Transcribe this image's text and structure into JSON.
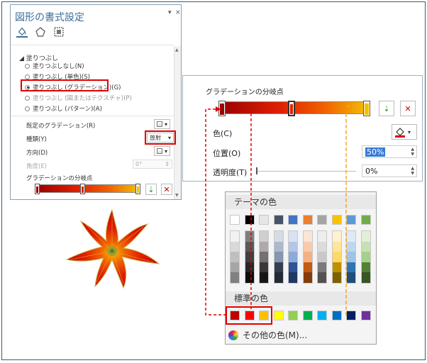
{
  "pane": {
    "title": "図形の書式設定",
    "pin_glyph": "▾",
    "close_glyph": "×",
    "tabs": [
      "fill-line-icon",
      "effects-icon",
      "size-properties-icon"
    ],
    "section": "塗りつぶし",
    "radios": [
      {
        "label": "塗りつぶしなし(N)",
        "checked": false,
        "dim": false
      },
      {
        "label": "塗りつぶし (単色)(S)",
        "checked": false,
        "dim": false
      },
      {
        "label": "塗りつぶし (グラデーション)(G)",
        "checked": true,
        "dim": false
      },
      {
        "label": "塗りつぶし (図またはテクスチャ)(P)",
        "checked": false,
        "dim": true
      },
      {
        "label": "塗りつぶし (パターン)(A)",
        "checked": false,
        "dim": false
      }
    ],
    "preset_label": "既定のグラデーション(R)",
    "type_label": "種類(Y)",
    "type_value": "放射",
    "direction_label": "方向(D)",
    "angle_label": "角度(E)",
    "angle_value": "0°",
    "stops_label": "グラデーションの分岐点"
  },
  "panel2": {
    "stops_label": "グラデーションの分岐点",
    "color_label": "色(C)",
    "position_label": "位置(O)",
    "position_value": "50%",
    "transparency_label": "透明度(T)",
    "transparency_value": "0%"
  },
  "popup": {
    "theme_header": "テーマの色",
    "standard_header": "標準の色",
    "more_colors": "その他の色(M)...",
    "theme_top": [
      "#ffffff",
      "#000000",
      "#e7e6e6",
      "#44546a",
      "#4472c4",
      "#ed7d31",
      "#a5a5a5",
      "#ffc000",
      "#5b9bd5",
      "#70ad47"
    ],
    "theme_columns": [
      [
        "#f2f2f2",
        "#d9d9d9",
        "#bfbfbf",
        "#a6a6a6",
        "#808080"
      ],
      [
        "#7f7f7f",
        "#595959",
        "#404040",
        "#262626",
        "#0d0d0d"
      ],
      [
        "#d0cece",
        "#aeaaaa",
        "#757171",
        "#3a3838",
        "#161616"
      ],
      [
        "#d6dce4",
        "#acb9ca",
        "#8496b0",
        "#333f50",
        "#222a35"
      ],
      [
        "#d9e2f3",
        "#b4c6e7",
        "#8eaadb",
        "#2f5496",
        "#1f3864"
      ],
      [
        "#fbe5d5",
        "#f7cbac",
        "#f4b183",
        "#c55a11",
        "#843c0b"
      ],
      [
        "#ededed",
        "#dbdbdb",
        "#c9c9c9",
        "#7b7b7b",
        "#525252"
      ],
      [
        "#fff2cc",
        "#fee599",
        "#ffd965",
        "#bf9000",
        "#7f6000"
      ],
      [
        "#deebf6",
        "#bdd7ee",
        "#9dc3e6",
        "#2e75b5",
        "#1f4e79"
      ],
      [
        "#e2efd9",
        "#c5e0b3",
        "#a8d08d",
        "#538135",
        "#375623"
      ]
    ],
    "standard": [
      "#c00000",
      "#ff0000",
      "#ffc000",
      "#ffff00",
      "#92d050",
      "#00b050",
      "#00b0f0",
      "#0070c0",
      "#002060",
      "#7030a0"
    ]
  },
  "colors": {
    "accent_red": "#e00000",
    "guide_orange": "#f5a623",
    "guide_red": "#e00000",
    "title_blue": "#3d6c9a"
  }
}
